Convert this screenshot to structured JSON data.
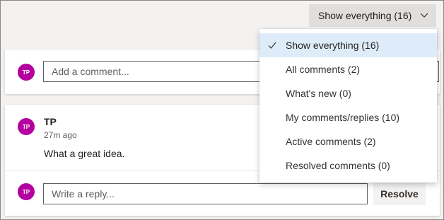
{
  "filter": {
    "button_label": "Show everything (16)",
    "icon": "chevron-down-icon"
  },
  "menu": {
    "items": [
      {
        "label": "Show everything (16)",
        "selected": true
      },
      {
        "label": "All comments (2)",
        "selected": false
      },
      {
        "label": "What's new (0)",
        "selected": false
      },
      {
        "label": "My comments/replies (10)",
        "selected": false
      },
      {
        "label": "Active comments (2)",
        "selected": false
      },
      {
        "label": "Resolved comments (0)",
        "selected": false
      }
    ],
    "check_icon": "checkmark-icon"
  },
  "new_comment": {
    "avatar_initials": "TP",
    "placeholder": "Add a comment..."
  },
  "thread": {
    "avatar_initials": "TP",
    "author": "TP",
    "time": "27m ago",
    "text": "What a great idea.",
    "reply_avatar_initials": "TP",
    "reply_placeholder": "Write a reply...",
    "resolve_label": "Resolve"
  },
  "colors": {
    "avatar": "#b4009e",
    "selected_item": "#deecf9",
    "button_bg": "#e1dfdd",
    "background": "#f3f2f1"
  }
}
